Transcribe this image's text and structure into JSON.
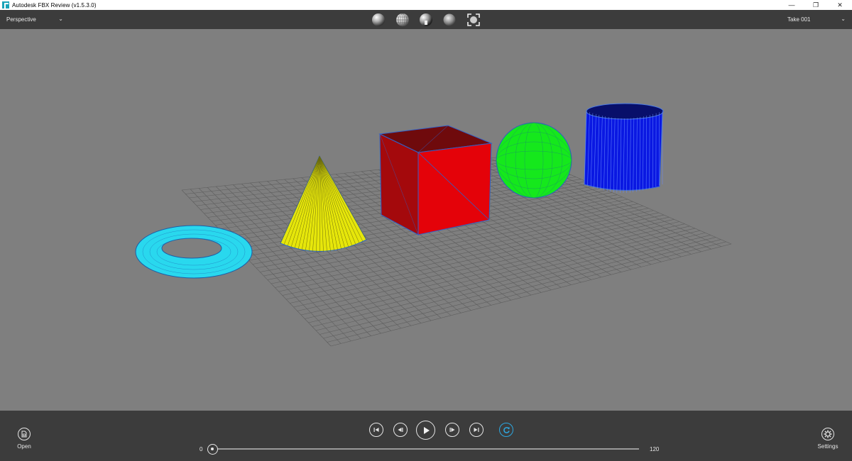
{
  "window": {
    "title": "Autodesk FBX Review (v1.5.3.0)",
    "controls": {
      "minimize": "—",
      "maximize": "❐",
      "close": "✕"
    }
  },
  "toolbar": {
    "camera": {
      "selected": "Perspective"
    },
    "take": {
      "selected": "Take 001"
    },
    "shading_modes": [
      {
        "name": "shaded-sphere-icon"
      },
      {
        "name": "wireframe-sphere-icon"
      },
      {
        "name": "lighting-sphere-icon"
      },
      {
        "name": "smooth-sphere-icon"
      },
      {
        "name": "frame-selection-icon"
      }
    ]
  },
  "viewport": {
    "objects": [
      {
        "name": "torus",
        "color": "#29d8ee"
      },
      {
        "name": "cone",
        "color": "#e6e60a"
      },
      {
        "name": "cube",
        "color": "#e4060b"
      },
      {
        "name": "sphere",
        "color": "#15e81c"
      },
      {
        "name": "cylinder",
        "color": "#0a18e2"
      }
    ],
    "grid": true
  },
  "bottom": {
    "open_label": "Open",
    "settings_label": "Settings",
    "playback": [
      "go-to-start-icon",
      "step-back-icon",
      "play-icon",
      "step-forward-icon",
      "go-to-end-icon",
      "loop-icon"
    ],
    "timeline": {
      "start": "0",
      "end": "120",
      "current_frame": 0
    }
  },
  "colors": {
    "accent": "#2da7e0",
    "panel": "#3c3c3c",
    "viewport_bg": "#7f7f7f"
  }
}
